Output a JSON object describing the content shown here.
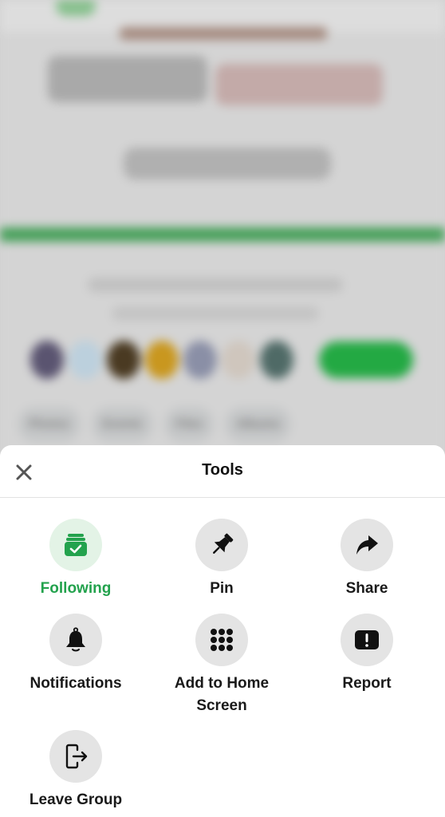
{
  "background": {
    "description": "blurred group page",
    "tabs": [
      "Photos",
      "Events",
      "Files",
      "Albums"
    ],
    "avatar_colors": [
      "#5a5470",
      "#bcd0dd",
      "#4a3a22",
      "#c9971f",
      "#8a8fa6",
      "#cfc6bd",
      "#4f6a66"
    ],
    "accent_color": "#23a943"
  },
  "sheet": {
    "title": "Tools",
    "close_icon": "close-icon",
    "tools": [
      {
        "id": "following",
        "label": "Following",
        "icon": "following-check-icon",
        "active": true,
        "color": "#23a24d"
      },
      {
        "id": "pin",
        "label": "Pin",
        "icon": "pin-icon",
        "active": false
      },
      {
        "id": "share",
        "label": "Share",
        "icon": "share-arrow-icon",
        "active": false
      },
      {
        "id": "notifications",
        "label": "Notifications",
        "icon": "bell-icon",
        "active": false
      },
      {
        "id": "add-to-home",
        "label": "Add to Home Screen",
        "icon": "grid-dots-icon",
        "active": false
      },
      {
        "id": "report",
        "label": "Report",
        "icon": "report-exclamation-icon",
        "active": false
      },
      {
        "id": "leave-group",
        "label": "Leave Group",
        "icon": "leave-door-icon",
        "active": false
      }
    ]
  }
}
